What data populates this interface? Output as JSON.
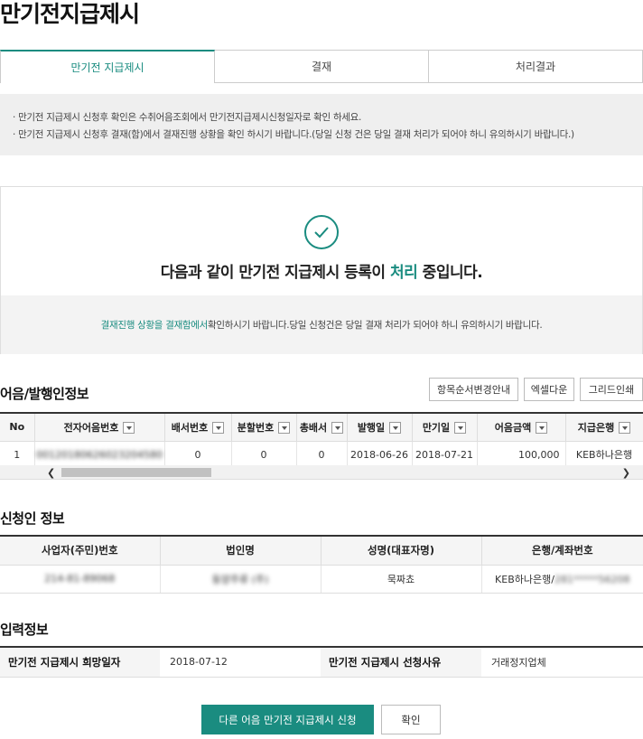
{
  "page_title": "만기전지급제시",
  "tabs": [
    {
      "label": "만기전 지급제시"
    },
    {
      "label": "결재"
    },
    {
      "label": "처리결과"
    }
  ],
  "notice": [
    "· 만기전 지급제시 신청후 확인은 수취어음조회에서 만기전지급제시신청일자로 확인 하세요.",
    "· 만기전 지급제시 신청후 결재(함)에서 결재진행 상황을 확인 하시기 바랍니다.(당일 신청 건은 당일 결재 처리가 되어야 하니 유의하시기 바랍니다.)"
  ],
  "result": {
    "msg_before": "다음과 같이 만기전 지급제시 등록이 ",
    "msg_highlight": "처리",
    "msg_after": " 중입니다.",
    "sub_highlight": "결재진행 상황을 결재함에서",
    "sub_rest": " 확인하시기 바랍니다.당일 신청건은 당일 결재 처리가 되어야 하니 유의하시기 바랍니다."
  },
  "bill_section": {
    "title": "어음/발행인정보",
    "buttons": {
      "reorder": "항목순서변경안내",
      "excel": "엑셀다운",
      "print": "그리드인쇄"
    },
    "columns": [
      "No",
      "전자어음번호",
      "배서번호",
      "분할번호",
      "총배서",
      "발행일",
      "만기일",
      "어음금액",
      "지급은행"
    ],
    "row": {
      "no": "1",
      "bill_no": "00120180626023204580",
      "endorse_no": "0",
      "split_no": "0",
      "total_endorse": "0",
      "issue_date": "2018-06-26",
      "due_date": "2018-07-21",
      "amount": "100,000",
      "bank": "KEB하나은행"
    }
  },
  "applicant_section": {
    "title": "신청인 정보",
    "columns": [
      "사업자(주민)번호",
      "법인명",
      "성명(대표자명)",
      "은행/계좌번호"
    ],
    "row": {
      "biz_no": "214-81-89068",
      "corp_name": "동양주류 (주)",
      "rep_name": "묵짜쵸",
      "bank_prefix": "KEB하나은행/",
      "account": "281*****56208"
    }
  },
  "input_section": {
    "title": "입력정보",
    "label_date": "만기전 지급제시 희망일자",
    "value_date": "2018-07-12",
    "label_reason": "만기전 지급제시 선청사유",
    "value_reason": "거래정지업체"
  },
  "buttons": {
    "apply_other": "다른 어음 만기전 지급제시 신청",
    "confirm": "확인"
  },
  "colors": {
    "accent": "#1a8c80"
  }
}
